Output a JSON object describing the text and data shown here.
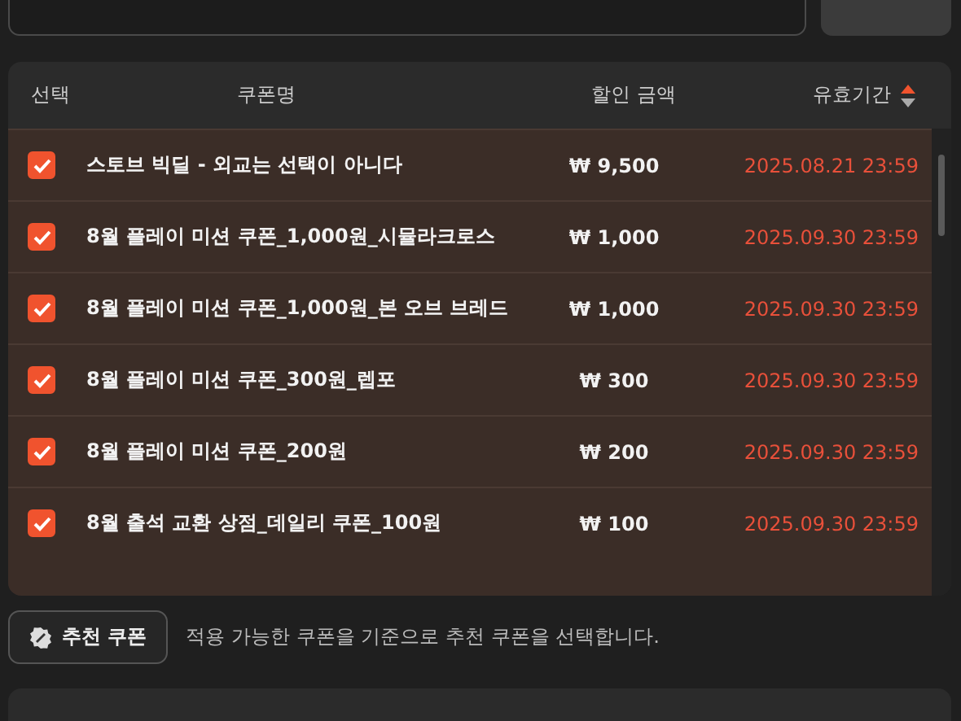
{
  "table": {
    "columns": [
      {
        "label": "선택"
      },
      {
        "label": "쿠폰명"
      },
      {
        "label": "할인 금액"
      },
      {
        "label": "유효기간",
        "sorted_ascending": true
      }
    ],
    "rows": [
      {
        "checked": true,
        "name": "스토브 빅딜 - 외교는 선택이 아니다",
        "amount": "₩ 9,500",
        "expires": "2025.08.21 23:59"
      },
      {
        "checked": true,
        "name": "8월 플레이 미션 쿠폰_1,000원_시뮬라크로스",
        "amount": "₩ 1,000",
        "expires": "2025.09.30 23:59"
      },
      {
        "checked": true,
        "name": "8월 플레이 미션 쿠폰_1,000원_본 오브 브레드",
        "amount": "₩ 1,000",
        "expires": "2025.09.30 23:59"
      },
      {
        "checked": true,
        "name": "8월 플레이 미션 쿠폰_300원_렙포",
        "amount": "₩ 300",
        "expires": "2025.09.30 23:59"
      },
      {
        "checked": true,
        "name": "8월 플레이 미션 쿠폰_200원",
        "amount": "₩ 200",
        "expires": "2025.09.30 23:59"
      },
      {
        "checked": true,
        "name": "8월 출석 교환 상점_데일리 쿠폰_100원",
        "amount": "₩ 100",
        "expires": "2025.09.30 23:59"
      }
    ]
  },
  "recommend": {
    "button": "추천 쿠폰",
    "description": "적용 가능한 쿠폰을 기준으로 추천 쿠폰을 선택합니다."
  }
}
